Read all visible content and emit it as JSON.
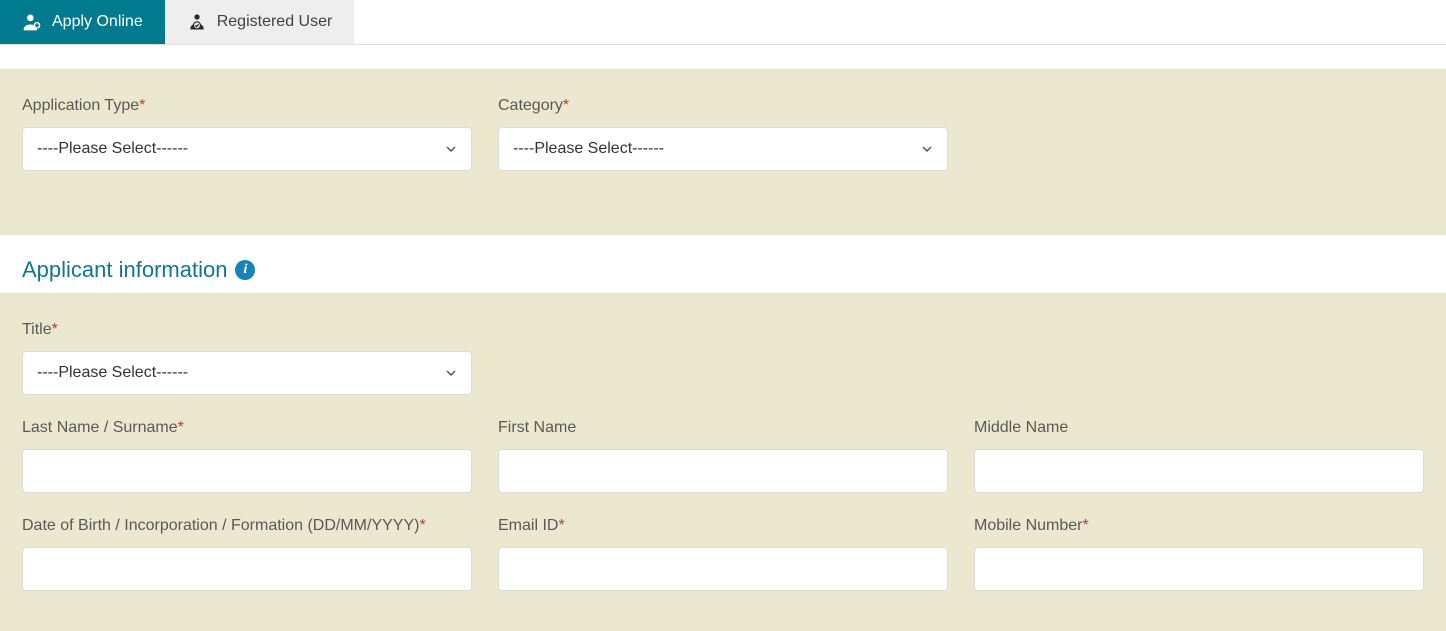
{
  "tabs": {
    "apply": "Apply Online",
    "registered": "Registered User"
  },
  "top": {
    "application_type_label": "Application Type",
    "application_type_value": "----Please Select------",
    "category_label": "Category",
    "category_value": "----Please Select------"
  },
  "section_heading": "Applicant information",
  "form": {
    "title_label": "Title",
    "title_value": "----Please Select------",
    "last_name_label": "Last Name / Surname",
    "first_name_label": "First Name",
    "middle_name_label": "Middle Name",
    "dob_label": "Date of Birth / Incorporation / Formation (DD/MM/YYYY)",
    "email_label": "Email ID",
    "mobile_label": "Mobile Number"
  },
  "asterisk": "*"
}
